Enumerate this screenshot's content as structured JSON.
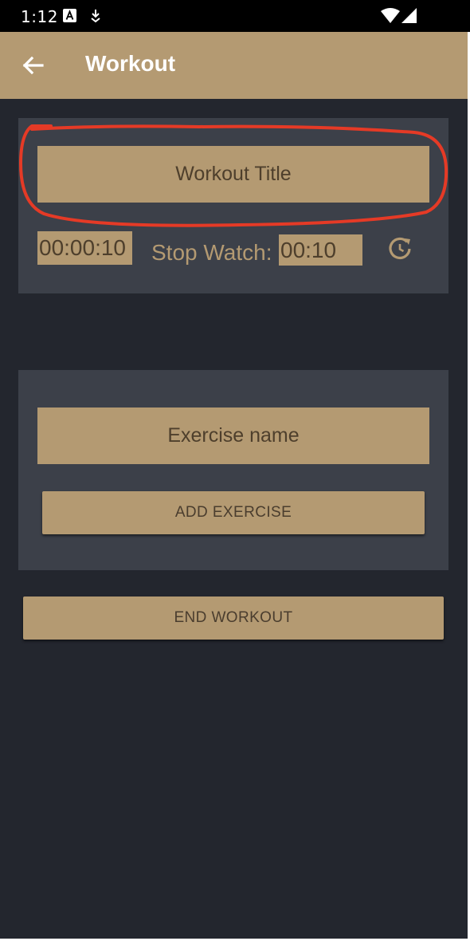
{
  "status_bar": {
    "time": "1:12"
  },
  "app_bar": {
    "title": "Workout"
  },
  "workout_card": {
    "title_placeholder": "Workout Title",
    "timer_value": "00:00:10",
    "stopwatch_label": "Stop Watch:",
    "stopwatch_value": "00:10"
  },
  "exercise_card": {
    "exercise_placeholder": "Exercise name",
    "add_button_label": "ADD EXERCISE"
  },
  "end_button_label": "END WORKOUT",
  "colors": {
    "app_bar": "#b49a72",
    "background": "#23262e",
    "card": "#3c4049",
    "accent": "#b49a72",
    "annotation": "#e53a26"
  }
}
